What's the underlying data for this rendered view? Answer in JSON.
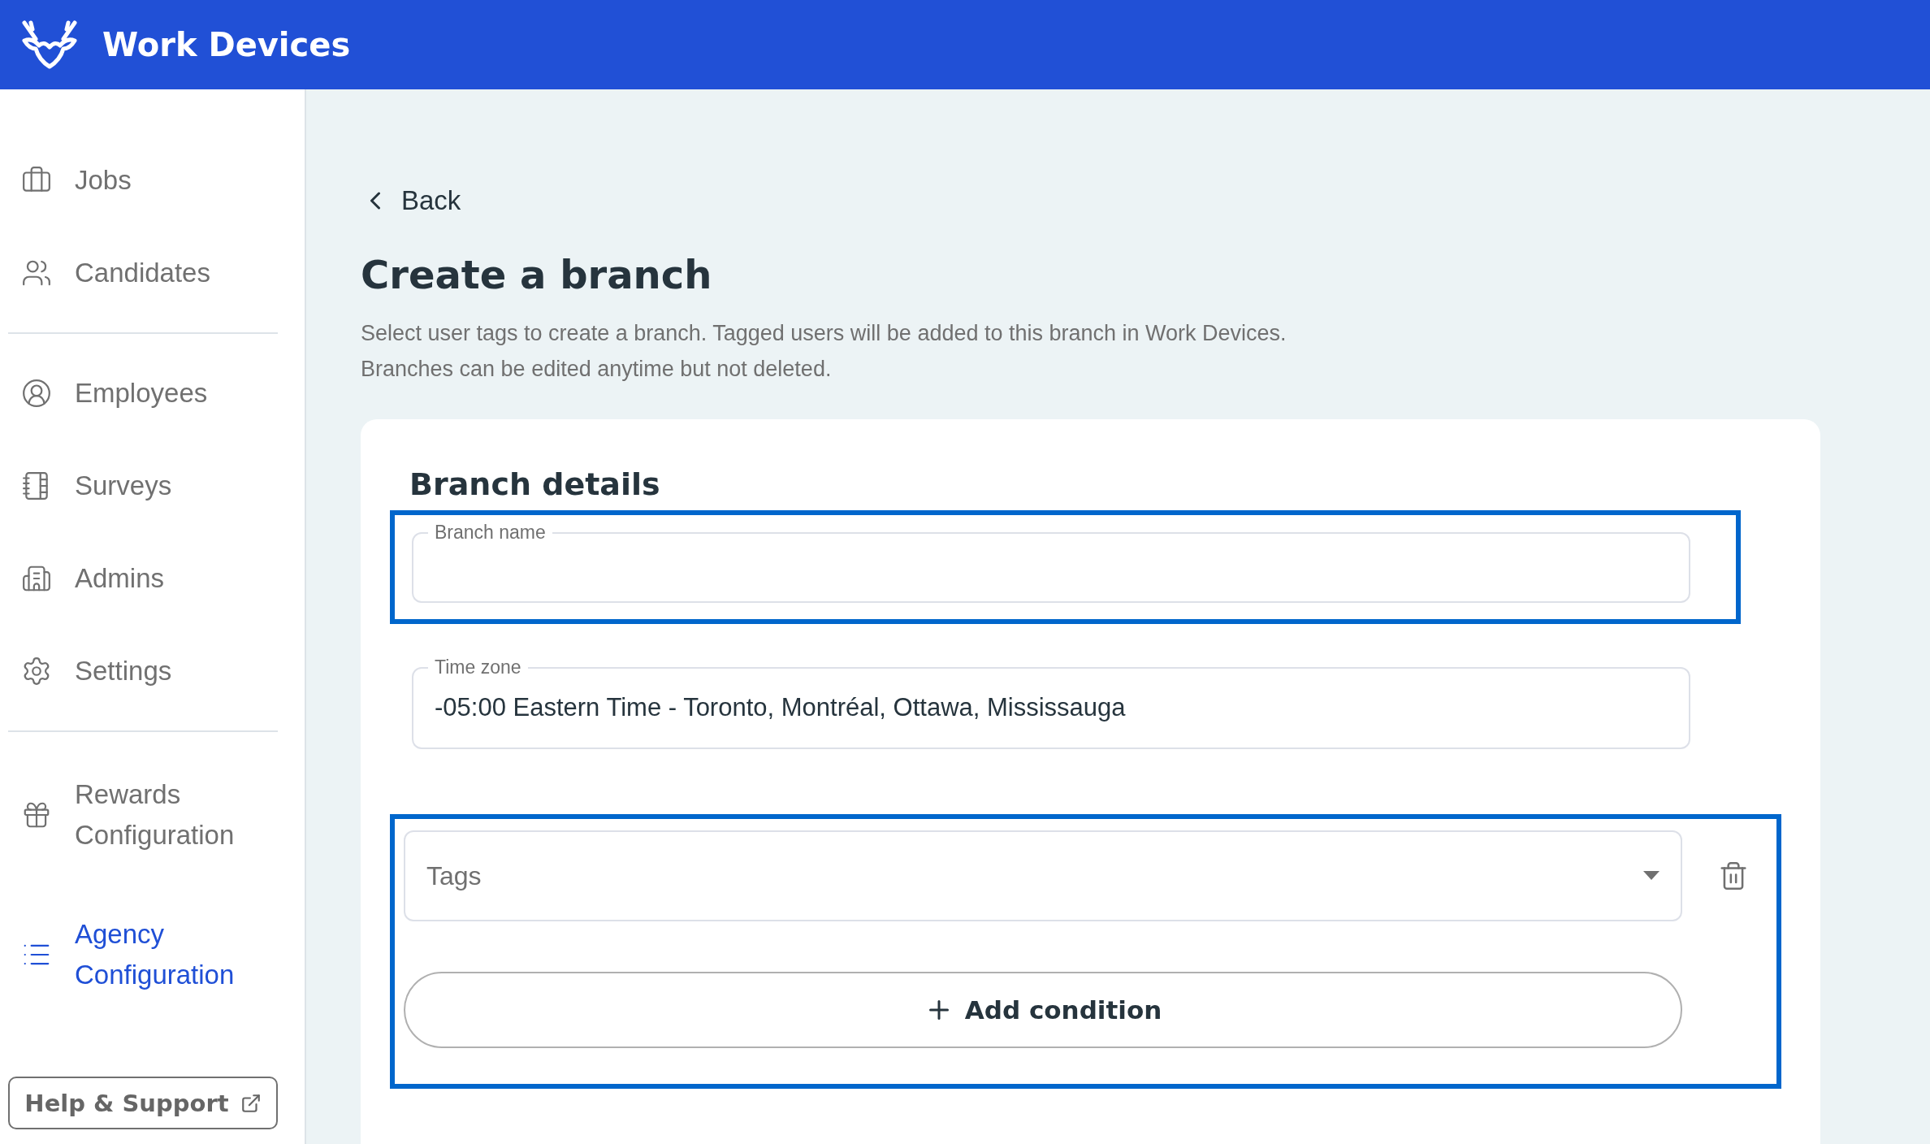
{
  "header": {
    "title": "Work Devices"
  },
  "sidebar": {
    "groups": [
      [
        {
          "label": "Jobs",
          "selected": false
        },
        {
          "label": "Candidates",
          "selected": false
        }
      ],
      [
        {
          "label": "Employees",
          "selected": false
        },
        {
          "label": "Surveys",
          "selected": false
        },
        {
          "label": "Admins",
          "selected": false
        },
        {
          "label": "Settings",
          "selected": false
        }
      ],
      [
        {
          "label": "Rewards\nConfiguration",
          "selected": false
        },
        {
          "label": "Agency\nConfiguration",
          "selected": true
        }
      ]
    ],
    "help_button": "Help & Support"
  },
  "page": {
    "back": "Back",
    "title": "Create a branch",
    "description": [
      "Select user tags to create a branch. Tagged users will be added to this branch in Work Devices.",
      "Branches can be edited anytime but not deleted."
    ]
  },
  "branch_details": {
    "title": "Branch details",
    "fields": [
      {
        "kind": "text",
        "label": "Branch name",
        "highlighted": true
      },
      {
        "kind": "text",
        "label": "Time zone",
        "value": "-05:00 Eastern Time - Toronto, Montréal, Ottawa, Mississauga",
        "highlighted": false
      }
    ]
  },
  "conditions": {
    "highlighted": true,
    "rows": [
      {
        "placeholder": "Tags"
      }
    ],
    "add_button": "Add condition"
  }
}
